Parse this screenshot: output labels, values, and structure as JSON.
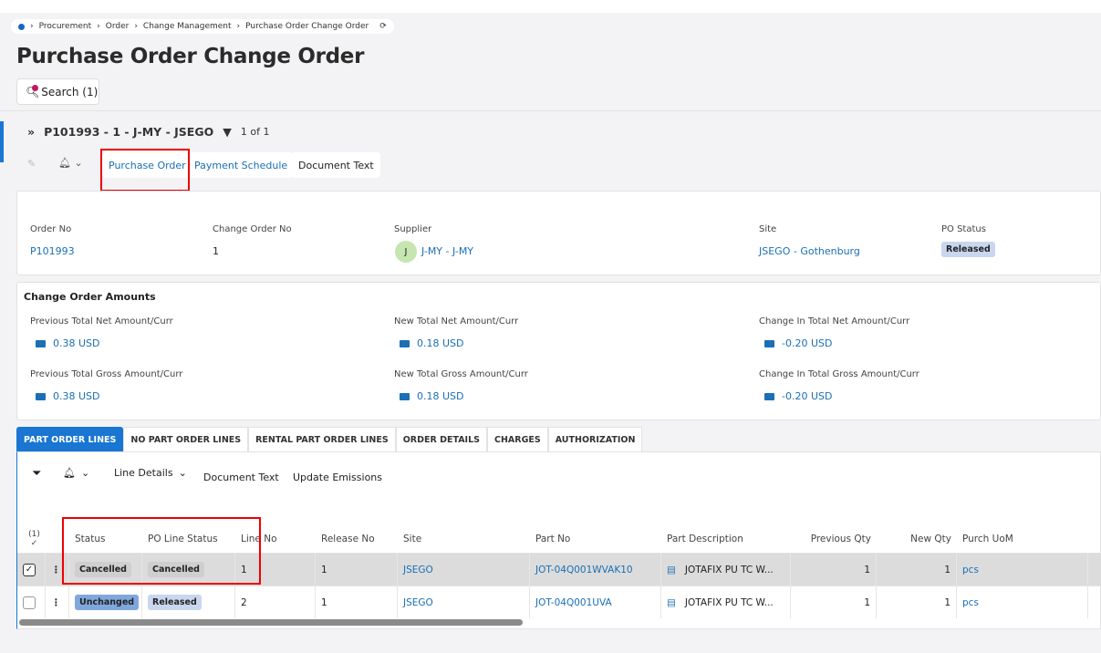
{
  "breadcrumb": [
    "Procurement",
    "Order",
    "Change Management",
    "Purchase Order Change Order"
  ],
  "page_title": "Purchase Order Change Order",
  "search_label": "Search (1)",
  "record": {
    "title": "P101993 - 1 - J-MY - JSEGO",
    "counter": "1 of 1"
  },
  "commands": {
    "purchase_order": "Purchase Order",
    "payment_schedule": "Payment Schedule",
    "document_text": "Document Text"
  },
  "header": {
    "order_no_label": "Order No",
    "order_no": "P101993",
    "change_order_no_label": "Change Order No",
    "change_order_no": "1",
    "supplier_label": "Supplier",
    "supplier_avatar": "J",
    "supplier": "J-MY - J-MY",
    "site_label": "Site",
    "site": "JSEGO - Gothenburg",
    "po_status_label": "PO Status",
    "po_status": "Released"
  },
  "amounts": {
    "title": "Change Order Amounts",
    "prev_net_label": "Previous Total Net Amount/Curr",
    "prev_net": "0.38 USD",
    "new_net_label": "New Total Net Amount/Curr",
    "new_net": "0.18 USD",
    "chg_net_label": "Change In Total Net Amount/Curr",
    "chg_net": "-0.20 USD",
    "prev_gross_label": "Previous Total Gross Amount/Curr",
    "prev_gross": "0.38 USD",
    "new_gross_label": "New Total Gross Amount/Curr",
    "new_gross": "0.18 USD",
    "chg_gross_label": "Change In Total Gross Amount/Curr",
    "chg_gross": "-0.20 USD"
  },
  "tabs": [
    "PART ORDER LINES",
    "NO PART ORDER LINES",
    "RENTAL PART ORDER LINES",
    "ORDER DETAILS",
    "CHARGES",
    "AUTHORIZATION"
  ],
  "grid_toolbar": {
    "line_details": "Line Details",
    "document_text": "Document Text",
    "update_emissions": "Update Emissions"
  },
  "grid": {
    "selected_count": "(1)",
    "columns": [
      "Status",
      "PO Line Status",
      "Line No",
      "Release No",
      "Site",
      "Part No",
      "Part Description",
      "Previous Qty",
      "New Qty",
      "Purch UoM"
    ],
    "rows": [
      {
        "status": "Cancelled",
        "po_line_status": "Cancelled",
        "line_no": "1",
        "release_no": "1",
        "site": "JSEGO",
        "part_no": "JOT-04Q001WVAK10",
        "part_desc": "JOTAFIX PU TC W...",
        "prev_qty": "1",
        "new_qty": "1",
        "uom": "pcs"
      },
      {
        "status": "Unchanged",
        "po_line_status": "Released",
        "line_no": "2",
        "release_no": "1",
        "site": "JSEGO",
        "part_no": "JOT-04Q001UVA",
        "part_desc": "JOTAFIX PU TC W...",
        "prev_qty": "1",
        "new_qty": "1",
        "uom": "pcs"
      }
    ]
  }
}
